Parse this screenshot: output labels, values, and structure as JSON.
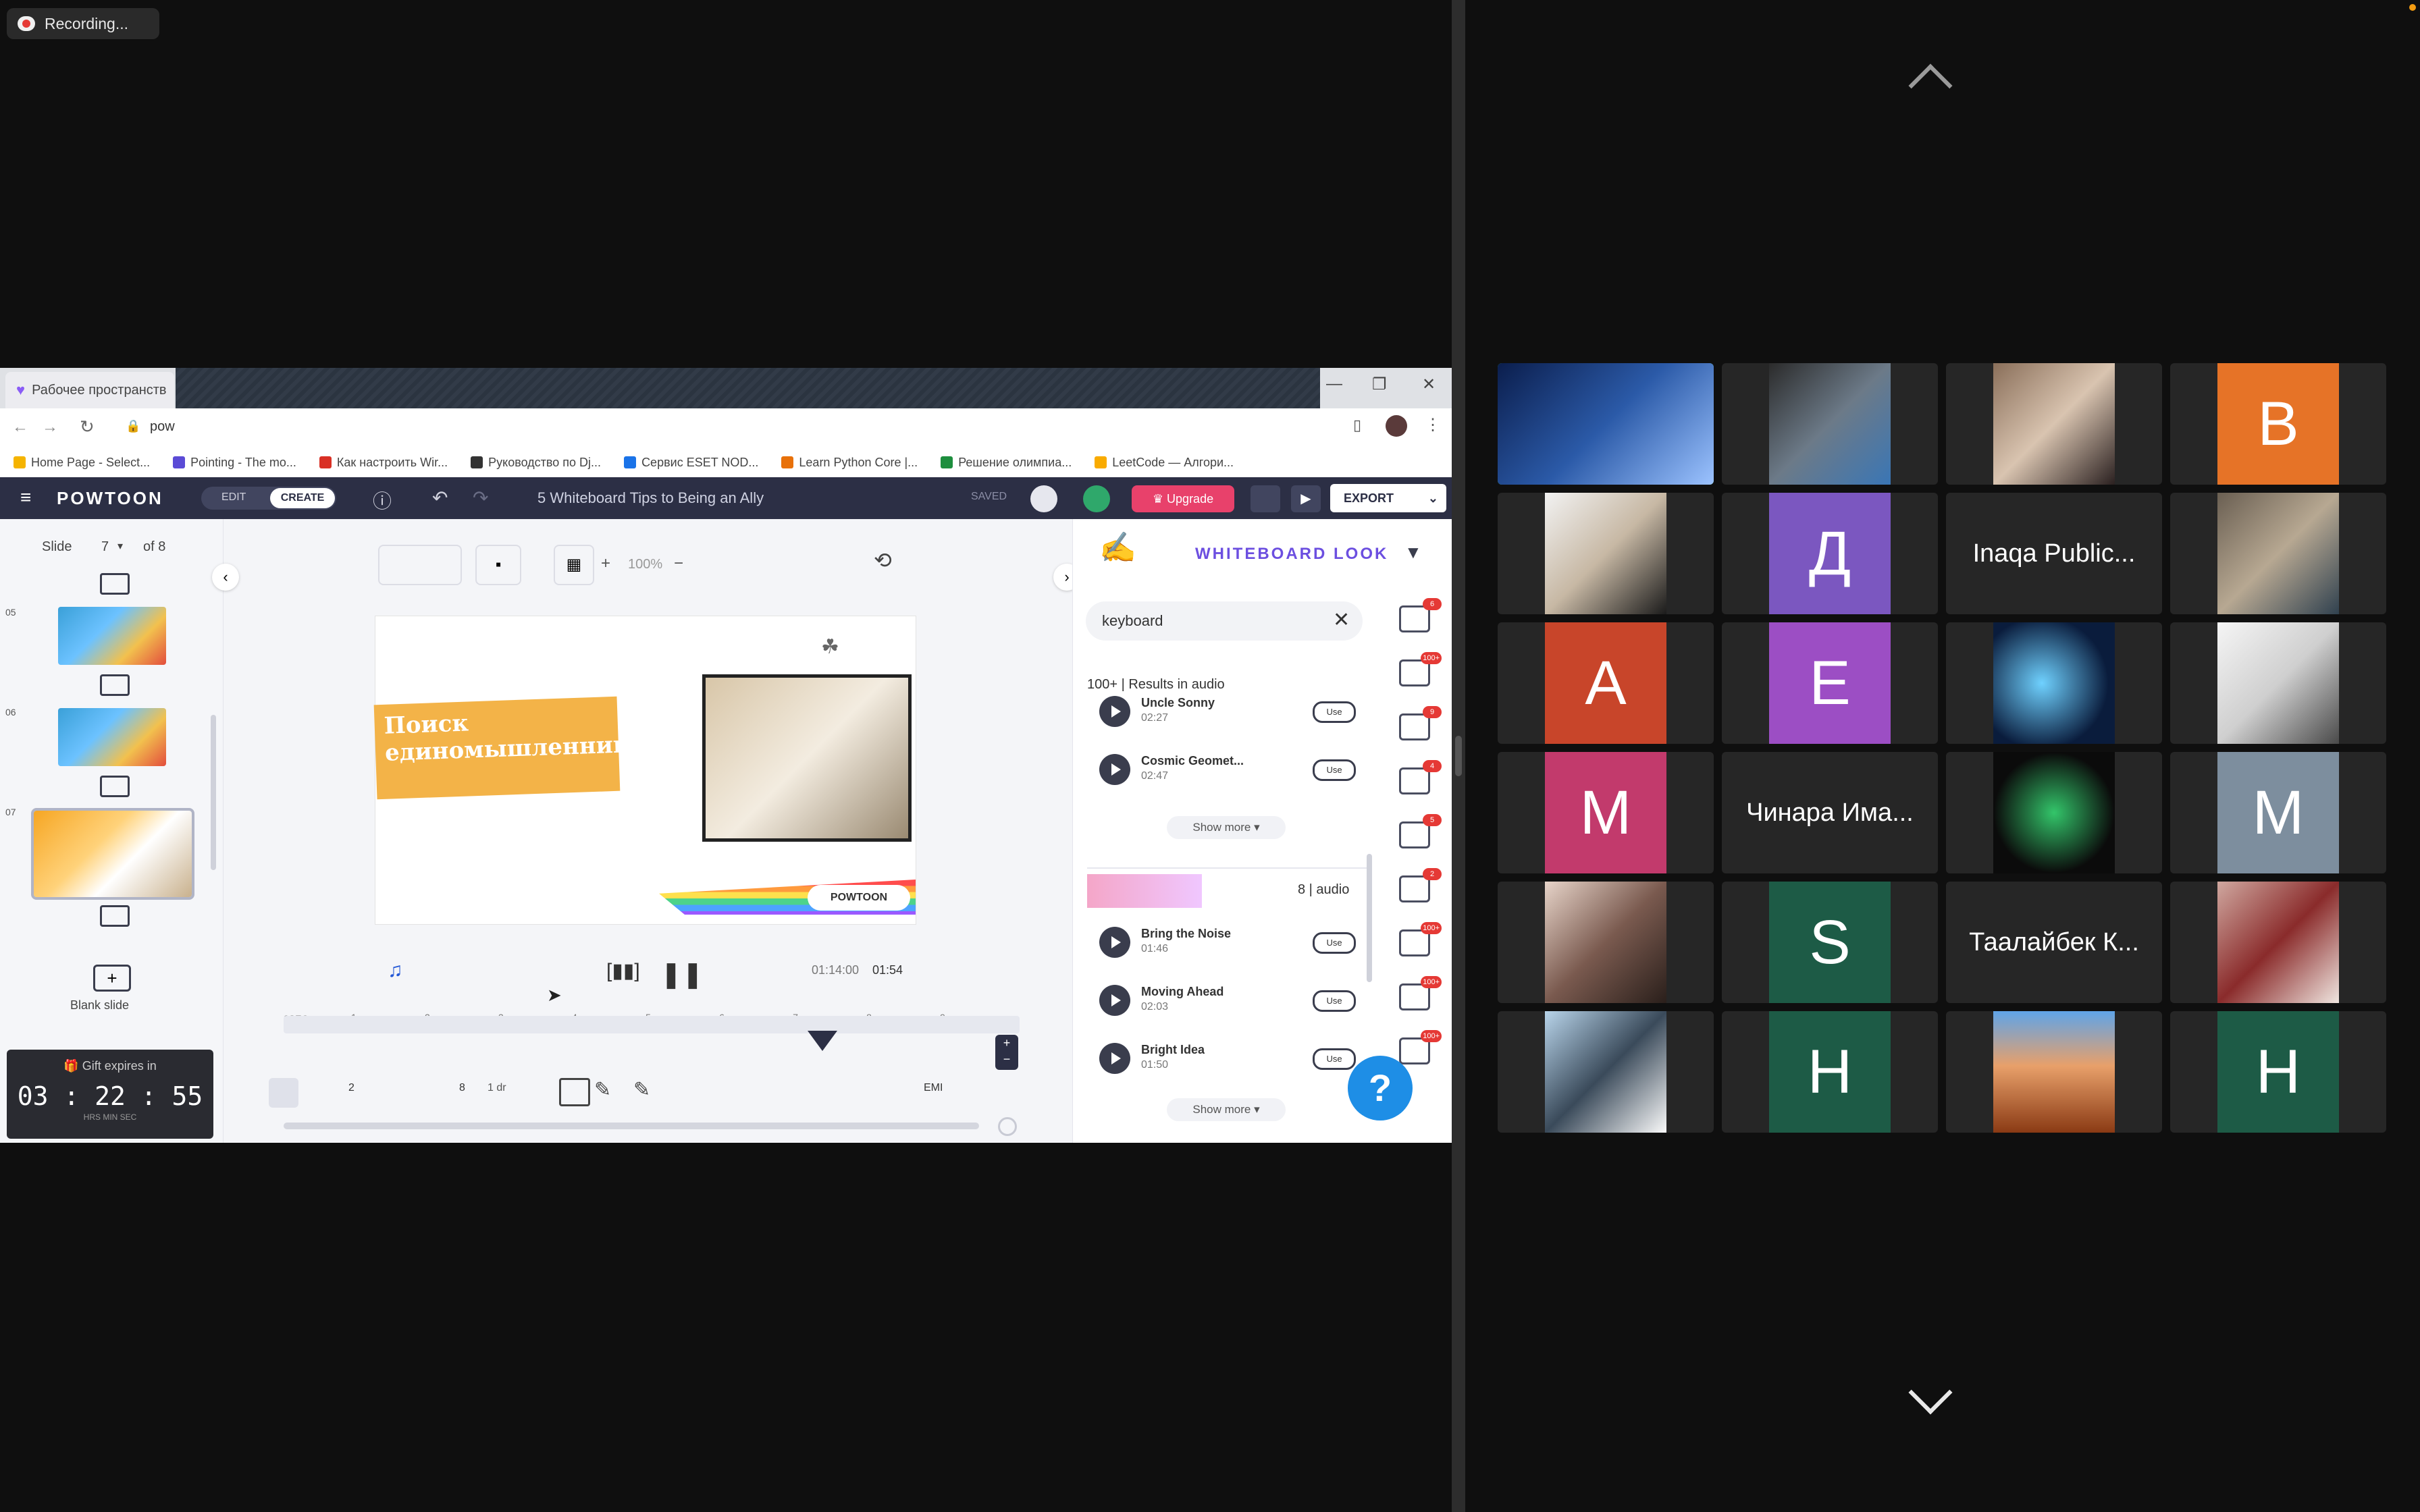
{
  "recording": {
    "label": "Recording..."
  },
  "browser": {
    "tab_title": "Рабочее пространство",
    "address": "pow",
    "bookmarks": [
      "Home Page - Select...",
      "Pointing - The mo...",
      "Как настроить Wir...",
      "Руководство по Dj...",
      "Сервис ESET NOD...",
      "Learn Python Core |...",
      "Решение олимпиа...",
      "LeetCode — Алгори..."
    ]
  },
  "powtoon": {
    "logo": "POWTOON",
    "edit_label": "EDIT",
    "create_label": "CREATE",
    "title": "5 Whiteboard Tips to Being an Ally",
    "saved_label": "SAVED",
    "upgrade_label": "Upgrade",
    "export_label": "EXPORT",
    "slide_label": "Slide",
    "slide_number": "7",
    "slide_of": "of 8",
    "thumb_numbers": [
      "05",
      "06",
      "07"
    ],
    "blank_slide_label": "Blank slide",
    "gift_label": "Gift expires in",
    "gift_timer": "03 : 22 : 55",
    "gift_units": "HRS  MIN  SEC",
    "zoom_label": "100%",
    "canvas_banner": "Поиск единомышленников",
    "canvas_brand": "POWTOON",
    "time_current": "01:14:00",
    "time_total": "01:54",
    "timeline_start": "0SEC",
    "timeline_ticks": [
      "1",
      "2",
      "3",
      "4",
      "5",
      "6",
      "7",
      "8",
      "9"
    ],
    "tl_labels": [
      "2",
      "8",
      "1 dr",
      "EMI"
    ],
    "panel_title": "WHITEBOARD LOOK",
    "search_value": "keyboard",
    "results_label": "100+ | Results in audio",
    "tracks_a": [
      {
        "name": "Uncle Sonny",
        "dur": "02:27",
        "use": "Use"
      },
      {
        "name": "Cosmic Geomet...",
        "dur": "02:47",
        "use": "Use"
      }
    ],
    "show_more": "Show more ▾",
    "audio_count": "8 | audio",
    "tracks_b": [
      {
        "name": "Bring the Noise",
        "dur": "01:46",
        "use": "Use"
      },
      {
        "name": "Moving Ahead",
        "dur": "02:03",
        "use": "Use"
      },
      {
        "name": "Bright Idea",
        "dur": "01:50",
        "use": "Use"
      }
    ],
    "side_badges": [
      "6",
      "100+",
      "9",
      "4",
      "5",
      "2",
      "100+",
      "100+",
      "100+"
    ],
    "help_label": "?"
  },
  "gallery": {
    "tiles": [
      {
        "type": "photo",
        "name": "presenter"
      },
      {
        "type": "photo",
        "name": "participant-2"
      },
      {
        "type": "photo",
        "name": "participant-3"
      },
      {
        "type": "letter",
        "text": "B",
        "color": "#e67327"
      },
      {
        "type": "photo",
        "name": "participant-5"
      },
      {
        "type": "letter",
        "text": "Д",
        "color": "#7b57c0"
      },
      {
        "type": "name",
        "text": "Inaqa Public..."
      },
      {
        "type": "photo",
        "name": "participant-8"
      },
      {
        "type": "letter",
        "text": "A",
        "color": "#c8452a"
      },
      {
        "type": "letter",
        "text": "E",
        "color": "#9c4ec4"
      },
      {
        "type": "photo",
        "name": "participant-11"
      },
      {
        "type": "photo",
        "name": "participant-12"
      },
      {
        "type": "letter",
        "text": "M",
        "color": "#c23a6c"
      },
      {
        "type": "name",
        "text": "Чинара Има..."
      },
      {
        "type": "photo",
        "name": "participant-15"
      },
      {
        "type": "letter",
        "text": "M",
        "color": "#7d8e9e"
      },
      {
        "type": "photo",
        "name": "participant-17"
      },
      {
        "type": "letter",
        "text": "S",
        "color": "#1d5b46"
      },
      {
        "type": "name",
        "text": "Таалайбек К..."
      },
      {
        "type": "photo",
        "name": "participant-20"
      },
      {
        "type": "photo",
        "name": "participant-21"
      },
      {
        "type": "letter",
        "text": "H",
        "color": "#1d5b46"
      },
      {
        "type": "photo",
        "name": "participant-23"
      },
      {
        "type": "letter",
        "text": "H",
        "color": "#1d5b46"
      }
    ]
  }
}
